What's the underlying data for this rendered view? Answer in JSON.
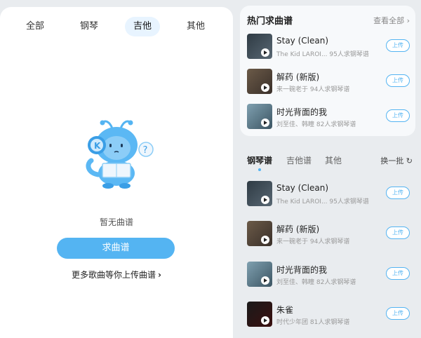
{
  "filter_tabs": [
    {
      "label": "全部",
      "active": false
    },
    {
      "label": "钢琴",
      "active": false
    },
    {
      "label": "吉他",
      "active": true
    },
    {
      "label": "其他",
      "active": false
    }
  ],
  "empty": {
    "text": "暂无曲谱",
    "button_label": "求曲谱",
    "more_text": "更多歌曲等你上传曲谱",
    "more_chevron": "›"
  },
  "hot": {
    "title": "热门求曲谱",
    "view_all": "查看全部 ›",
    "songs": [
      {
        "title": "Stay (Clean)",
        "meta": "The Kid LAROI...   95人求钢琴谱",
        "button": "上传"
      },
      {
        "title": "解药 (新版)",
        "meta": "来一碗老于   94人求钢琴谱",
        "button": "上传"
      },
      {
        "title": "时光背面的我",
        "meta": "刘至佳、韩瞳   82人求钢琴谱",
        "button": "上传"
      }
    ]
  },
  "sheet": {
    "tabs": [
      "钢琴谱",
      "吉他谱",
      "其他"
    ],
    "active_tab": 0,
    "refresh_label": "换一批 ↻",
    "songs": [
      {
        "title": "Stay (Clean)",
        "meta": "The Kid LAROI...   95人求钢琴谱",
        "button": "上传"
      },
      {
        "title": "解药 (新版)",
        "meta": "来一碗老于   94人求钢琴谱",
        "button": "上传"
      },
      {
        "title": "时光背面的我",
        "meta": "刘至佳、韩瞳   82人求钢琴谱",
        "button": "上传"
      },
      {
        "title": "朱雀",
        "meta": "时代少年团   81人求钢琴谱",
        "button": "上传"
      }
    ]
  },
  "colors": {
    "accent": "#54b4f2",
    "active_tab_bg": "#e8f4ff"
  }
}
